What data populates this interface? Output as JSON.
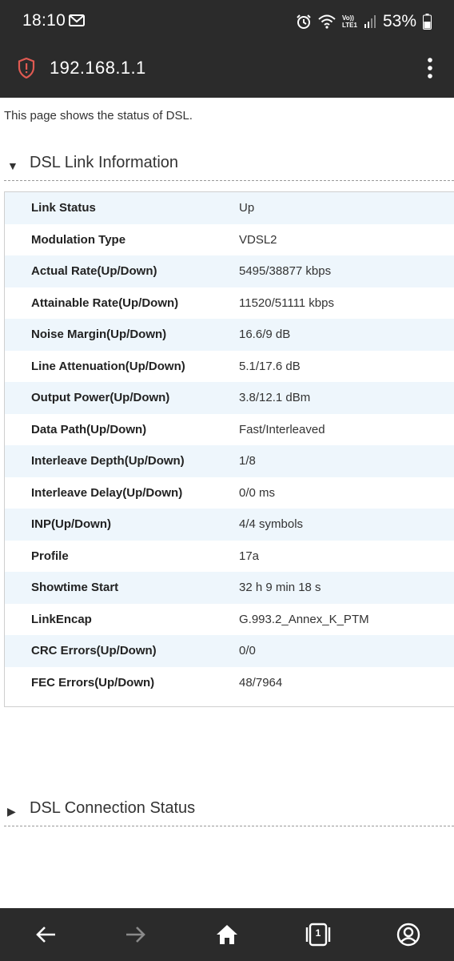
{
  "status_bar": {
    "time": "18:10",
    "battery": "53%",
    "network_label_top": "Vo))",
    "network_label_bottom": "LTE1",
    "icons": [
      "mail-icon",
      "alarm-icon",
      "wifi-icon",
      "signal-icon",
      "battery-icon"
    ]
  },
  "browser": {
    "url": "192.168.1.1",
    "icons": [
      "shield-warning-icon",
      "overflow-menu-icon"
    ]
  },
  "page": {
    "description": "This page shows the status of DSL.",
    "sections": [
      {
        "title": "DSL Link Information",
        "expanded": true
      },
      {
        "title": "DSL Connection Status",
        "expanded": false
      }
    ],
    "link_info": [
      {
        "label": "Link Status",
        "value": "Up"
      },
      {
        "label": "Modulation Type",
        "value": "VDSL2"
      },
      {
        "label": "Actual Rate(Up/Down)",
        "value": "5495/38877 kbps"
      },
      {
        "label": "Attainable Rate(Up/Down)",
        "value": "11520/51111 kbps"
      },
      {
        "label": "Noise Margin(Up/Down)",
        "value": "16.6/9 dB"
      },
      {
        "label": "Line Attenuation(Up/Down)",
        "value": "5.1/17.6 dB"
      },
      {
        "label": "Output Power(Up/Down)",
        "value": "3.8/12.1 dBm"
      },
      {
        "label": "Data Path(Up/Down)",
        "value": "Fast/Interleaved"
      },
      {
        "label": "Interleave Depth(Up/Down)",
        "value": "1/8"
      },
      {
        "label": "Interleave Delay(Up/Down)",
        "value": "0/0 ms"
      },
      {
        "label": "INP(Up/Down)",
        "value": "4/4 symbols"
      },
      {
        "label": "Profile",
        "value": "17a"
      },
      {
        "label": "Showtime Start",
        "value": "32 h 9 min 18 s"
      },
      {
        "label": "LinkEncap",
        "value": "G.993.2_Annex_K_PTM"
      },
      {
        "label": "CRC Errors(Up/Down)",
        "value": "0/0"
      },
      {
        "label": "FEC Errors(Up/Down)",
        "value": "48/7964"
      }
    ]
  },
  "bottom_nav": {
    "tab_count": "1",
    "icons": [
      "back-arrow-icon",
      "forward-arrow-icon",
      "home-icon",
      "tabs-icon",
      "account-icon"
    ]
  },
  "colors": {
    "chrome": "#2b2b2b",
    "row_alt": "#eef6fc",
    "shield": "#e05a52"
  }
}
